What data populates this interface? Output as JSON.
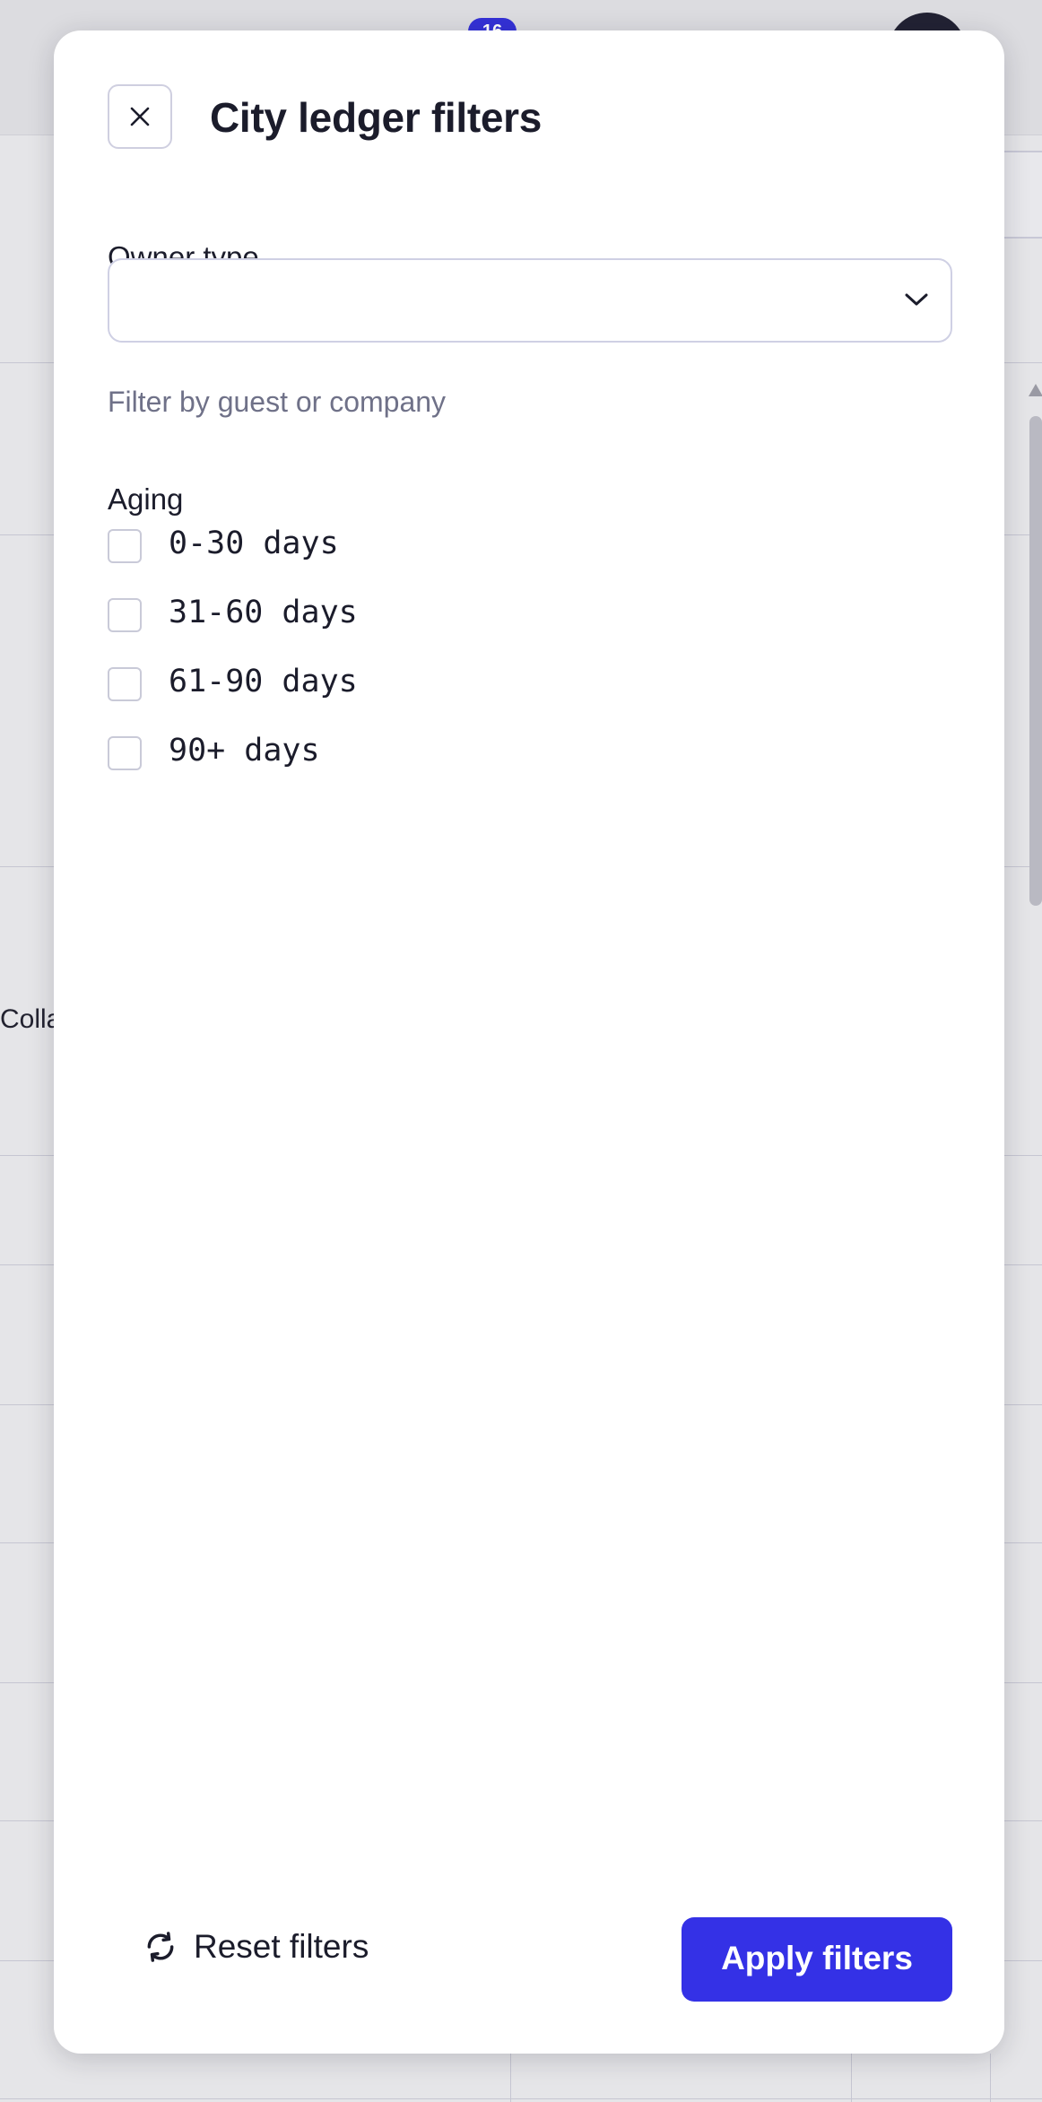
{
  "background": {
    "notification_count": "16",
    "row_text": "Collapse"
  },
  "drawer": {
    "title": "City ledger filters",
    "close_icon": "close-icon",
    "owner_type": {
      "label": "Owner type",
      "value": "",
      "helper": "Filter by guest or company",
      "icon": "chevron-down-icon"
    },
    "aging": {
      "label": "Aging",
      "options": [
        {
          "label": "0-30 days",
          "checked": false
        },
        {
          "label": "31-60 days",
          "checked": false
        },
        {
          "label": "61-90 days",
          "checked": false
        },
        {
          "label": "90+ days",
          "checked": false
        }
      ]
    },
    "footer": {
      "reset_label": "Reset filters",
      "reset_icon": "refresh-icon",
      "apply_label": "Apply filters"
    }
  },
  "colors": {
    "accent": "#3431e6",
    "helper_text": "#6f7188",
    "border": "#cfd0e4"
  }
}
